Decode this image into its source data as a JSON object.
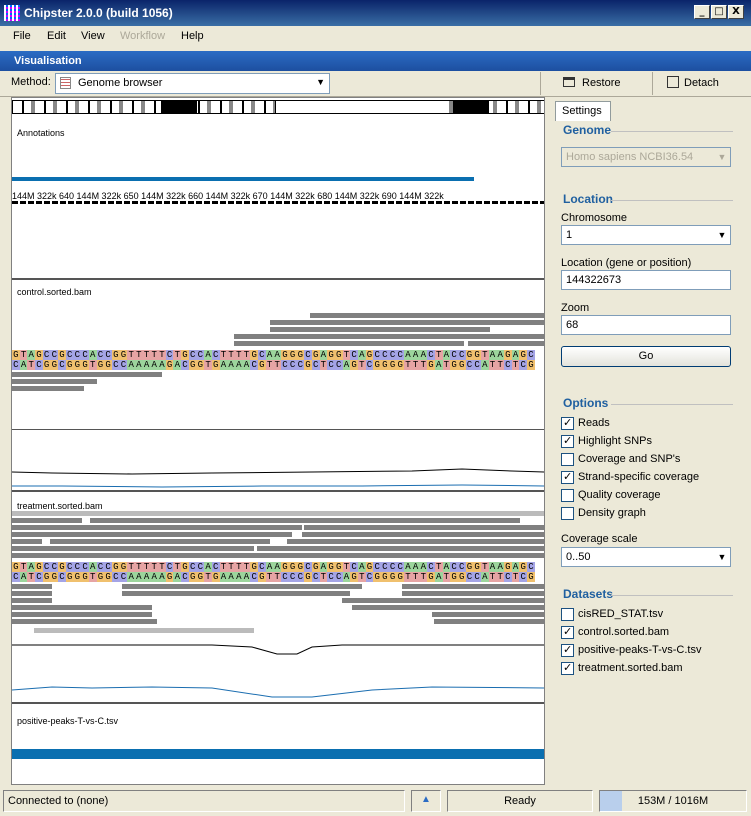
{
  "window": {
    "title": "Chipster 2.0.0 (build 1056)",
    "buttons": [
      "_",
      "□",
      "X"
    ]
  },
  "menu": {
    "items": [
      "File",
      "Edit",
      "View",
      "Workflow",
      "Help"
    ]
  },
  "visualisation": {
    "header": "Visualisation",
    "method_label": "Method:",
    "method_value": "Genome browser",
    "restore_label": "Restore",
    "detach_label": "Detach"
  },
  "tracks": {
    "annotations": "Annotations",
    "ruler_text": "144M 322k 640   144M 322k 650   144M 322k 660   144M 322k 670   144M 322k 680   144M 322k 690   144M 322k",
    "control": "control.sorted.bam",
    "treatment": "treatment.sorted.bam",
    "peaks": "positive-peaks-T-vs-C.tsv",
    "seq_forward": "GTAGCCGCCCACCGGTTTTTCTGCCACTTTTGCAAGGGCGAGGTCAGCCCCAAACTACCGGTAAGAGC",
    "seq_reverse": "CATCGGCGGGTGGCCAAAAAGACGGTGAAAACGTTCCCGCTCCAGTCGGGGTTTGATGGCCATTCTCG"
  },
  "settings": {
    "tab": "Settings",
    "genome": {
      "title": "Genome",
      "value": "Homo sapiens NCBI36.54"
    },
    "location": {
      "title": "Location",
      "chromosome_label": "Chromosome",
      "chromosome_value": "1",
      "position_label": "Location (gene or position)",
      "position_value": "144322673",
      "zoom_label": "Zoom",
      "zoom_value": "68",
      "go_label": "Go"
    },
    "options": {
      "title": "Options",
      "items": [
        {
          "label": "Reads",
          "checked": true
        },
        {
          "label": "Highlight SNPs",
          "checked": true
        },
        {
          "label": "Coverage and SNP's",
          "checked": false
        },
        {
          "label": "Strand-specific coverage",
          "checked": true
        },
        {
          "label": "Quality coverage",
          "checked": false
        },
        {
          "label": "Density graph",
          "checked": false
        }
      ],
      "coverage_scale_label": "Coverage scale",
      "coverage_scale_value": "0..50"
    },
    "datasets": {
      "title": "Datasets",
      "items": [
        {
          "label": "cisRED_STAT.tsv",
          "checked": false
        },
        {
          "label": "control.sorted.bam",
          "checked": true
        },
        {
          "label": "positive-peaks-T-vs-C.tsv",
          "checked": true
        },
        {
          "label": "treatment.sorted.bam",
          "checked": true
        }
      ]
    }
  },
  "status": {
    "connection": "Connected to (none)",
    "state": "Ready",
    "memory": "153M / 1016M",
    "memory_used_fraction": 0.15
  },
  "colors": {
    "accent": "#2b6cc4",
    "title_bar": "#0a246a",
    "peak_bar": "#0a6fb0"
  }
}
